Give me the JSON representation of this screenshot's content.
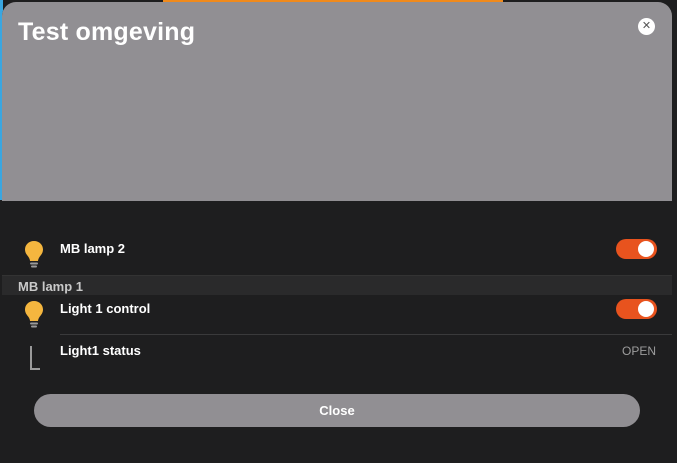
{
  "dialog": {
    "title": "Test omgeving",
    "close_icon": "close-icon"
  },
  "devices": [
    {
      "label": "MB lamp 2",
      "icon": "lightbulb-icon",
      "toggle_on": true
    }
  ],
  "section": {
    "title": "MB lamp 1",
    "items": [
      {
        "label": "Light 1 control",
        "icon": "lightbulb-icon",
        "toggle_on": true
      },
      {
        "label": "Light1 status",
        "icon": "corner-icon",
        "value": "OPEN"
      }
    ]
  },
  "footer": {
    "close_label": "Close"
  },
  "colors": {
    "header_bg": "#918f93",
    "body_bg": "#1e1e1f",
    "toggle_on": "#e8531e",
    "bulb": "#f4b63f"
  }
}
